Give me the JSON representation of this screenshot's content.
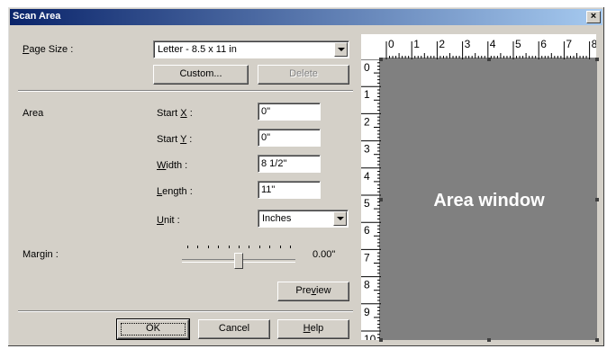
{
  "window": {
    "title": "Scan Area"
  },
  "page_size": {
    "label_pre": "",
    "label_ul": "P",
    "label_post": "age Size :",
    "value": "Letter - 8.5 x 11 in"
  },
  "buttons": {
    "custom": "Custom...",
    "delete": "Delete",
    "preview_pre": "Pre",
    "preview_ul": "v",
    "preview_post": "iew",
    "ok": "OK",
    "cancel": "Cancel",
    "help_ul": "H",
    "help_post": "elp"
  },
  "area": {
    "label": "Area",
    "start_x": {
      "pre": "Start ",
      "ul": "X",
      "post": " :",
      "value": "0\""
    },
    "start_y": {
      "pre": "Start ",
      "ul": "Y",
      "post": " :",
      "value": "0\""
    },
    "width": {
      "pre": "",
      "ul": "W",
      "post": "idth :",
      "value": "8 1/2\""
    },
    "length": {
      "pre": "",
      "ul": "L",
      "post": "ength :",
      "value": "11\""
    },
    "unit": {
      "pre": "",
      "ul": "U",
      "post": "nit :",
      "value": "Inches"
    }
  },
  "margin": {
    "pre": "Mar",
    "ul": "g",
    "post": "in :",
    "value": "0.00\"",
    "level": 0.5
  },
  "preview": {
    "area_text": "Area window",
    "ruler_top": [
      "0",
      "1",
      "2",
      "3",
      "4",
      "5",
      "6",
      "7",
      "8"
    ],
    "ruler_left": [
      "0",
      "1",
      "2",
      "3",
      "4",
      "5",
      "6",
      "7",
      "8",
      "9",
      "10"
    ]
  }
}
